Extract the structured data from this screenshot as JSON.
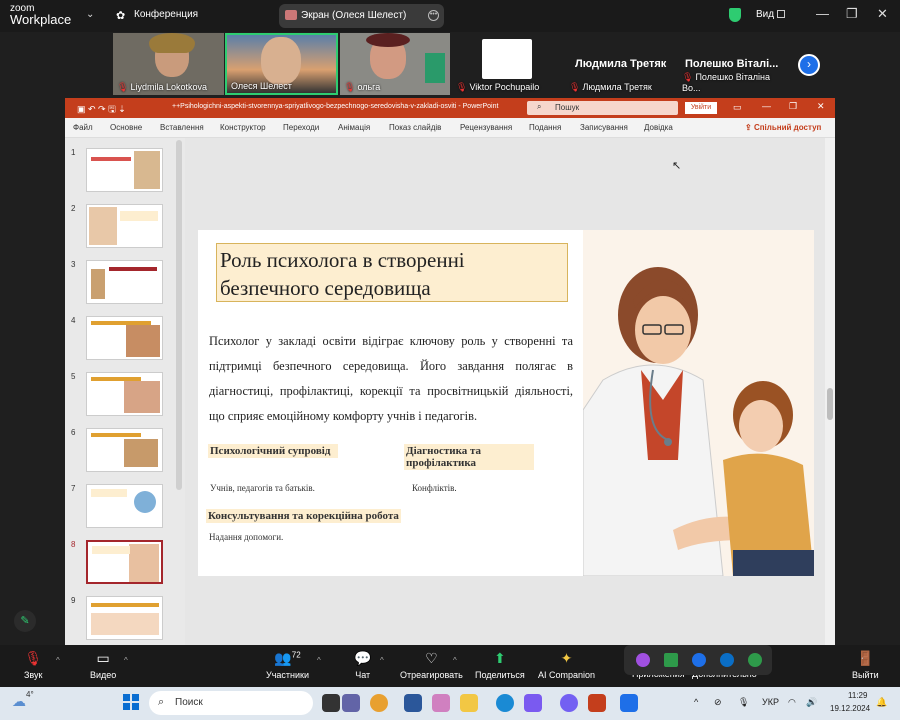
{
  "zoom": {
    "logo_top": "zoom",
    "logo_bottom": "Workplace",
    "meeting_label": "Конференция",
    "share_label": "Экран (Олеся Шелест)",
    "view_label": "Вид"
  },
  "participants": [
    {
      "name": "Liydmila Lokotkova"
    },
    {
      "name": "Олеся Шелест"
    },
    {
      "name": "ольга"
    },
    {
      "name": "Viktor Pochupailo"
    },
    {
      "name": "Людмила Третяк",
      "big": "Людмила Третяк"
    },
    {
      "name": "Полешко Віталіна Во...",
      "big": "Полешко  Віталі..."
    }
  ],
  "ppt": {
    "window_title": "++Psihologichni-aspekti-stvorennya-spriyatlivogo-bezpechnogo-seredovisha-v-zakladi-osviti  -  PowerPoint",
    "search_placeholder": "Пошук",
    "login_label": "Увійти",
    "menu": [
      "Файл",
      "Основне",
      "Вставлення",
      "Конструктор",
      "Переходи",
      "Анімація",
      "Показ слайдів",
      "Рецензування",
      "Подання",
      "Записування",
      "Довідка"
    ],
    "share_label": "Спільний доступ",
    "slide_numbers": [
      "1",
      "2",
      "3",
      "4",
      "5",
      "6",
      "7",
      "8",
      "9"
    ],
    "selected_slide": 8
  },
  "slide": {
    "title_line1": "Роль психолога в створенні",
    "title_line2": "безпечного середовища",
    "body": "Психолог у закладі освіти відіграє ключову роль у створенні та підтримці безпечного середовища. Його завдання полягає в діагностиці, профілактиці, корекції та просвітницькій діяльності, що сприяє емоційному комфорту учнів і педагогів.",
    "block1_head": "Психологічний супровід",
    "block1_text": "Учнів, педагогів та батьків.",
    "block2_head": "Діагностика та профілактика",
    "block2_text": "Конфліктів.",
    "block3_head": "Консультування та корекційна робота",
    "block3_text": "Надання допомоги."
  },
  "toolbar": {
    "sound": "Звук",
    "video": "Видео",
    "participants": "Участники",
    "participants_count": "72",
    "chat": "Чат",
    "react": "Отреагировать",
    "share": "Поделиться",
    "ai": "AI Companion",
    "apps": "Приложения",
    "more": "Дополнительно",
    "leave": "Выйти"
  },
  "taskbar": {
    "weather_temp": "4°",
    "search_placeholder": "Поиск",
    "lang": "УКР",
    "time": "11:29",
    "date": "19.12.2024"
  },
  "colors": {
    "ppt_red": "#c43e1c",
    "zoom_blue": "#1e6fe8",
    "share_green": "#2ecc71",
    "slide_heading_bg": "#fdeed0"
  }
}
